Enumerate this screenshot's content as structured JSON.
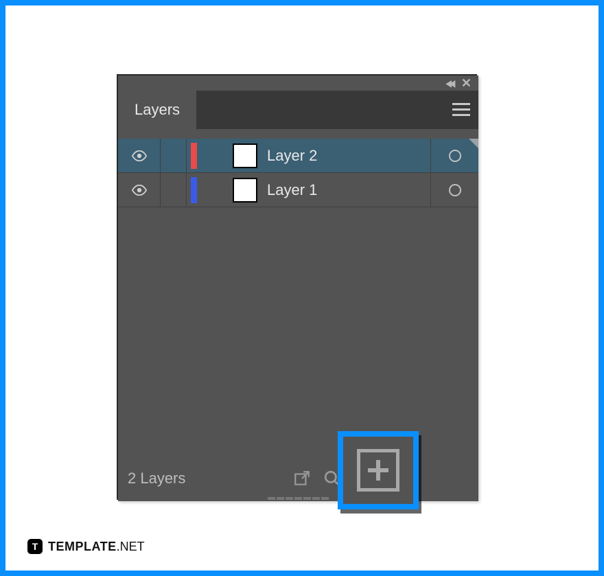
{
  "panel": {
    "tab_label": "Layers",
    "layers": [
      {
        "name": "Layer 2",
        "color": "#e94b4b",
        "selected": true
      },
      {
        "name": "Layer 1",
        "color": "#3a5be9",
        "selected": false
      }
    ],
    "footer_count_label": "2 Layers",
    "cutoff_char": "L"
  },
  "watermark": {
    "logo_letter": "T",
    "bold": "TEMPLATE",
    "thin": ".NET"
  }
}
